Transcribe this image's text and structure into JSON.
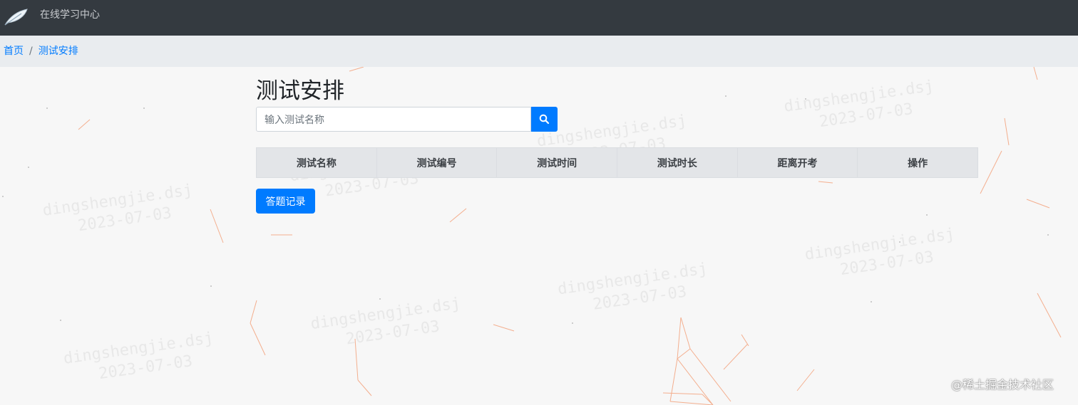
{
  "header": {
    "app_title": "在线学习中心",
    "icon": "feather-logo-icon"
  },
  "breadcrumb": {
    "home": "首页",
    "separator": "/",
    "current": "测试安排"
  },
  "main": {
    "title": "测试安排",
    "search": {
      "placeholder": "输入测试名称",
      "value": "",
      "icon": "search-icon"
    },
    "table": {
      "columns": [
        "测试名称",
        "测试编号",
        "测试时间",
        "测试时长",
        "距离开考",
        "操作"
      ],
      "rows": []
    },
    "record_button": "答题记录"
  },
  "watermark": {
    "line1": "dingshengjie.dsj",
    "line2": "2023-07-03"
  },
  "credit": "@稀土掘金技术社区",
  "colors": {
    "accent": "#007bff",
    "topbar": "#343a40",
    "breadcrumb_bg": "#e9ecef",
    "page_bg": "#f7f7f7",
    "particles": "#f08a5d"
  }
}
